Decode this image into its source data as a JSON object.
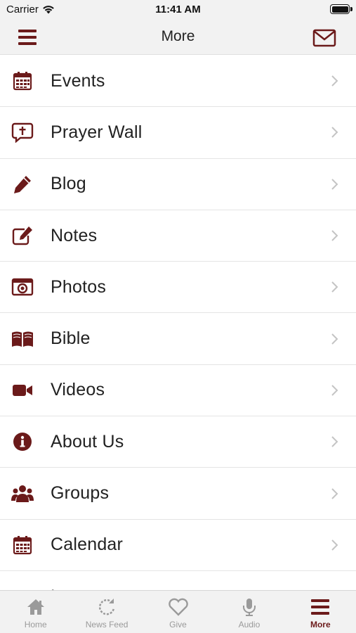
{
  "status_bar": {
    "carrier": "Carrier",
    "time": "11:41 AM"
  },
  "nav": {
    "title": "More",
    "menu_icon": "hamburger-menu-icon",
    "mail_icon": "mail-envelope-icon"
  },
  "accent_color": "#6b1a1a",
  "menu_items": [
    {
      "label": "Events",
      "icon": "calendar-icon"
    },
    {
      "label": "Prayer Wall",
      "icon": "prayer-bubble-icon"
    },
    {
      "label": "Blog",
      "icon": "pencil-icon"
    },
    {
      "label": "Notes",
      "icon": "edit-note-icon"
    },
    {
      "label": "Photos",
      "icon": "camera-icon"
    },
    {
      "label": "Bible",
      "icon": "open-book-icon"
    },
    {
      "label": "Videos",
      "icon": "video-camera-icon"
    },
    {
      "label": "About Us",
      "icon": "info-icon"
    },
    {
      "label": "Groups",
      "icon": "group-icon"
    },
    {
      "label": "Calendar",
      "icon": "calendar-icon"
    },
    {
      "label": "L",
      "icon": "partial-icon"
    }
  ],
  "tabs": [
    {
      "label": "Home",
      "icon": "home-icon",
      "active": false
    },
    {
      "label": "News Feed",
      "icon": "refresh-icon",
      "active": false
    },
    {
      "label": "Give",
      "icon": "heart-icon",
      "active": false
    },
    {
      "label": "Audio",
      "icon": "microphone-icon",
      "active": false
    },
    {
      "label": "More",
      "icon": "hamburger-menu-icon",
      "active": true
    }
  ]
}
